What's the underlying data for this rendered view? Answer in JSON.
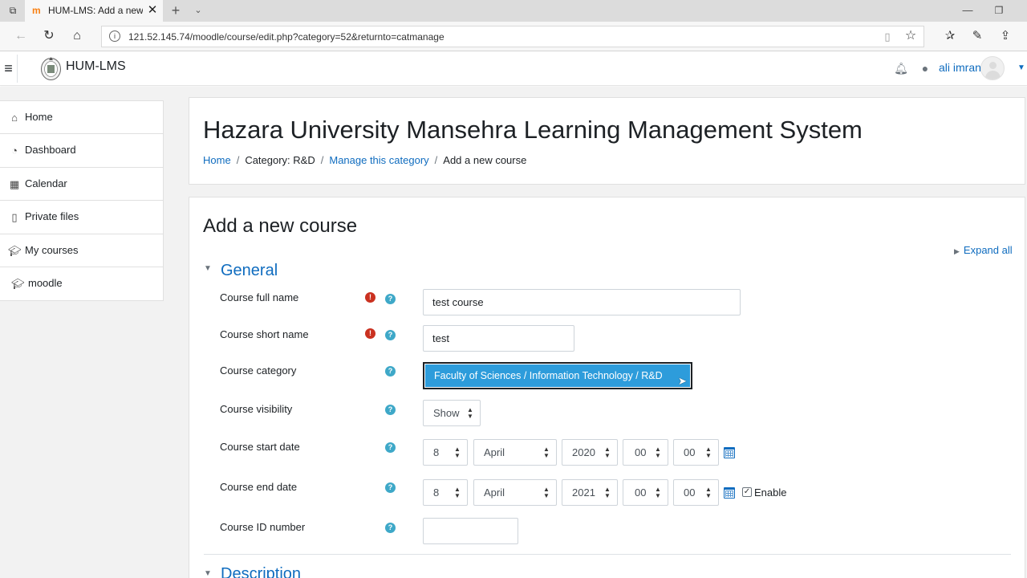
{
  "browser": {
    "tab_title": "HUM-LMS: Add a new course",
    "url": "121.52.145.74/moodle/course/edit.php?category=52&returnto=catmanage"
  },
  "navbar": {
    "site_name": "HUM-LMS",
    "username": "ali imran"
  },
  "drawer": {
    "items": [
      {
        "label": "Home",
        "icon": "home-icon"
      },
      {
        "label": "Dashboard",
        "icon": "dashboard-icon"
      },
      {
        "label": "Calendar",
        "icon": "calendar-icon"
      },
      {
        "label": "Private files",
        "icon": "file-icon"
      },
      {
        "label": "My courses",
        "icon": "graduation-cap-icon"
      },
      {
        "label": "moodle",
        "icon": "graduation-cap-icon"
      }
    ]
  },
  "header": {
    "title": "Hazara University Mansehra Learning Management System",
    "breadcrumb": [
      "Home",
      "Category: R&D",
      "Manage this category",
      "Add a new course"
    ]
  },
  "form": {
    "heading": "Add a new course",
    "expand_all": "Expand all",
    "section_general": "General",
    "section_description": "Description",
    "labels": {
      "full_name": "Course full name",
      "short_name": "Course short name",
      "category": "Course category",
      "visibility": "Course visibility",
      "start_date": "Course start date",
      "end_date": "Course end date",
      "id_number": "Course ID number"
    },
    "values": {
      "full_name": "test course",
      "short_name": "test",
      "category": "Faculty of Sciences / Information Technology / R&D",
      "visibility": "Show",
      "start_day": "8",
      "start_month": "April",
      "start_year": "2020",
      "start_hour": "00",
      "start_minute": "00",
      "end_day": "8",
      "end_month": "April",
      "end_year": "2021",
      "end_hour": "00",
      "end_minute": "00",
      "id_number": ""
    },
    "end_enable_label": "Enable",
    "end_enabled": true
  },
  "colors": {
    "link": "#0f6cbf",
    "required": "#ca3120",
    "help": "#3ea8c8",
    "selected_option": "#2d9cdb"
  }
}
